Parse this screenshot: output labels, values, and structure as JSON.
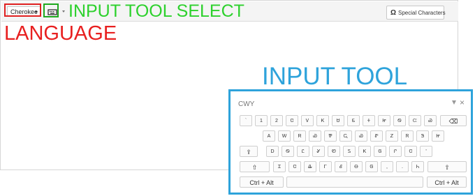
{
  "toolbar": {
    "language": "Cherokee",
    "special_characters": "Special Characters",
    "special_icon": "Ω"
  },
  "annotations": {
    "input_tool_select": "INPUT TOOL SELECT",
    "language": "LANGUAGE",
    "input_tool": "INPUT TOOL"
  },
  "keyboard": {
    "title": "CWY",
    "close": "×",
    "row1": [
      "`",
      "1",
      "2",
      "Ꮳ",
      "Ꮩ",
      "Ꮶ",
      "Ꮜ",
      "Ꮛ",
      "Ꮠ",
      "Ꮵ",
      "Ꮻ",
      "Ꮸ",
      "Ꮿ"
    ],
    "backspace": "⌫",
    "row2": [
      "A",
      "W",
      "R",
      "Ꮿ",
      "Ꮘ",
      "Ꮹ",
      "Ꮿ",
      "Ꮡ",
      "Ꮓ",
      "Ꮢ",
      "Ꮥ",
      "Ꮵ"
    ],
    "row3": [
      "D",
      "Ꮻ",
      "Ꮭ",
      "Ꮍ",
      "Ꮼ",
      "Ꮪ",
      "Ꮶ",
      "Ꮆ",
      "Ꮅ",
      "Ꮳ",
      "'"
    ],
    "caps": "⇪",
    "row4": [
      "Ꮖ",
      "Ꮳ",
      "Ꮂ",
      "Ꮁ",
      "Ꮄ",
      "Ꮎ",
      "Ꮆ",
      ",",
      ".",
      "Ꮒ"
    ],
    "shift": "⇧",
    "ctrl_alt": "Ctrl + Alt"
  }
}
